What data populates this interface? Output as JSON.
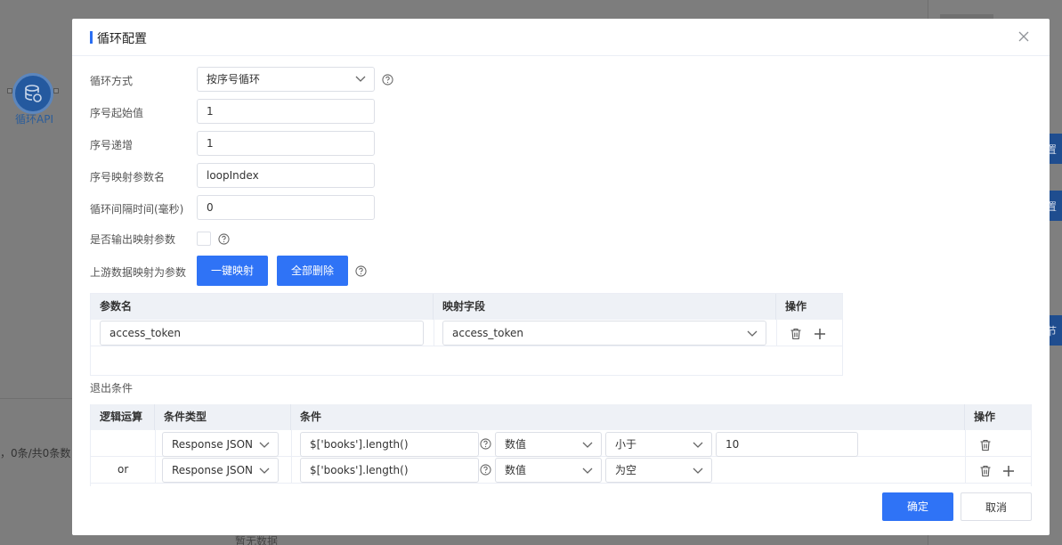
{
  "background": {
    "node_label": "循环API",
    "pager_text": "，0条/共0条数",
    "empty_text": "暂无数据",
    "side_buttons": [
      "置",
      "置",
      "节"
    ]
  },
  "modal": {
    "title": "循环配置",
    "fields": {
      "loop_mode_label": "循环方式",
      "loop_mode_value": "按序号循环",
      "start_label": "序号起始值",
      "start_value": "1",
      "step_label": "序号递增",
      "step_value": "1",
      "param_name_label": "序号映射参数名",
      "param_name_value": "loopIndex",
      "interval_label": "循环间隔时间(毫秒)",
      "interval_value": "0",
      "output_label": "是否输出映射参数",
      "upstream_label": "上游数据映射为参数"
    },
    "buttons": {
      "map_all": "一键映射",
      "delete_all": "全部删除",
      "confirm": "确定",
      "cancel": "取消"
    },
    "mapping_table": {
      "columns": [
        "参数名",
        "映射字段",
        "操作"
      ],
      "rows": [
        {
          "param": "access_token",
          "field": "access_token"
        }
      ]
    },
    "exit_section_label": "退出条件",
    "exit_table": {
      "columns": [
        "逻辑运算",
        "条件类型",
        "条件",
        "操作"
      ],
      "rows": [
        {
          "logic": "",
          "type": "Response JSON",
          "expr": "$['books'].length()",
          "value_type": "数值",
          "operator": "小于",
          "value": "10"
        },
        {
          "logic": "or",
          "type": "Response JSON",
          "expr": "$['books'].length()",
          "value_type": "数值",
          "operator": "为空",
          "value": ""
        }
      ]
    }
  },
  "colors": {
    "primary": "#2f73f6",
    "header_bg": "#eef1f6",
    "border": "#dcdfe6"
  }
}
